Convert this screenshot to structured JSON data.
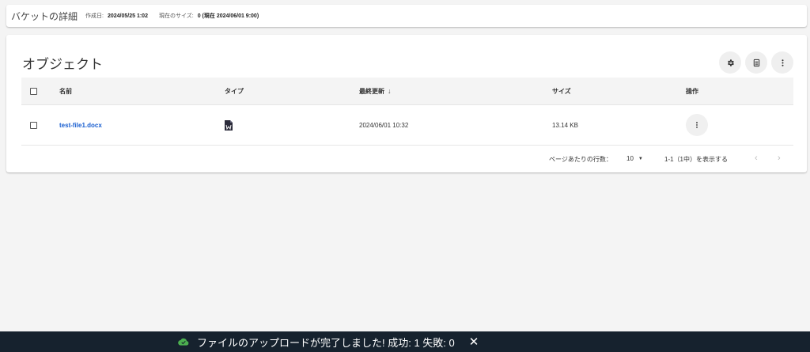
{
  "bucket": {
    "title": "バケットの詳細",
    "created_label": "作成日:",
    "created_value": "2024/05/25 1:02",
    "size_label": "現在のサイズ:",
    "size_value": "0 (現在 2024/06/01 9:00)"
  },
  "objects": {
    "title": "オブジェクト",
    "toolbar_icons": [
      "gear-icon",
      "columns-icon",
      "more-vert-icon"
    ],
    "columns": {
      "name": "名前",
      "type": "タイプ",
      "updated": "最終更新",
      "updated_sort": "↓",
      "size": "サイズ",
      "ops": "操作"
    },
    "rows": [
      {
        "name": "test-file1.docx",
        "type_icon": "word-document-icon",
        "updated": "2024/06/01 10:32",
        "size": "13.14 KB"
      }
    ],
    "pagination": {
      "rows_per_page_label": "ページあたりの行数：",
      "rows_per_page": "10",
      "range": "1-1（1中）を表示する",
      "prev": "‹",
      "next": "›"
    }
  },
  "snackbar": {
    "icon": "cloud-done-icon",
    "icon_color": "#4caf50",
    "message": "ファイルのアップロードが完了しました! 成功: 1 失敗: 0",
    "close": "✕"
  },
  "colors": {
    "link": "#1a5fd0",
    "snackbar_bg": "#16222e",
    "page_bg": "#f4f4f4"
  }
}
